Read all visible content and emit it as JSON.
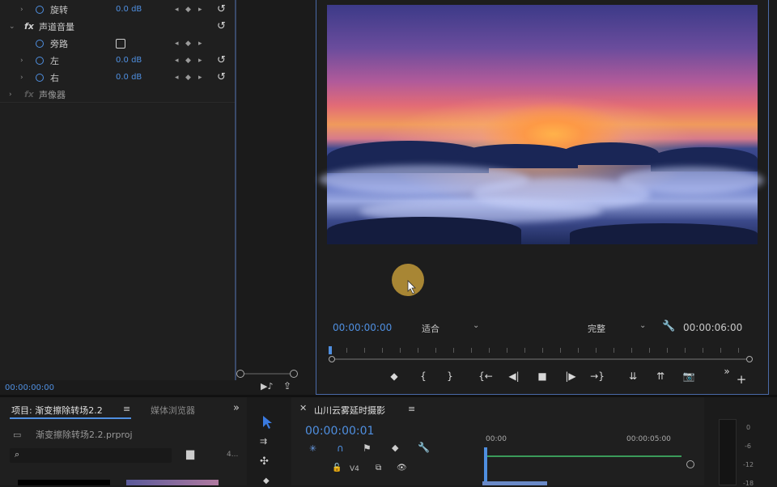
{
  "effects": {
    "rows": [
      {
        "label": "旋转",
        "value": "0.0 dB",
        "type": "param"
      },
      {
        "label": "声道音量",
        "type": "group"
      },
      {
        "label": "旁路",
        "type": "checkbox"
      },
      {
        "label": "左",
        "value": "0.0 dB",
        "type": "param"
      },
      {
        "label": "右",
        "value": "0.0 dB",
        "type": "param"
      },
      {
        "label": "声像器",
        "type": "group-disabled"
      }
    ],
    "fx_label": "fx",
    "timecode": "00:00:00:00"
  },
  "monitor": {
    "timecode_left": "00:00:00:00",
    "fit_label": "适合",
    "quality_label": "完整",
    "timecode_right": "00:00:06:00",
    "controls": {
      "marker": "◆",
      "mark_in": "{",
      "mark_out": "}",
      "go_in": "{←",
      "step_back": "◀|",
      "stop": "■",
      "step_fwd": "|▶",
      "go_out": "→}",
      "insert": "⇊",
      "overwrite": "⇈",
      "export": "📷",
      "more": "»",
      "add": "+"
    }
  },
  "project": {
    "tab_project": "项目: 渐变擦除转场2.2",
    "tab_media": "媒体浏览器",
    "more": "»",
    "file_name": "渐变擦除转场2.2.prproj",
    "page_dots": "4..."
  },
  "timeline": {
    "sequence_name": "山川云雾延时摄影",
    "timecode": "00:00:00:01",
    "ruler_start": "00:00",
    "ruler_mid": "00:00:05:00",
    "track_label": "V4"
  },
  "meter": {
    "labels": [
      "0",
      "-6",
      "-12",
      "-18"
    ]
  },
  "colors": {
    "accent_blue": "#4f8fe0",
    "panel_bg": "#1f1f1f",
    "border_blue": "#4a6aa8"
  }
}
